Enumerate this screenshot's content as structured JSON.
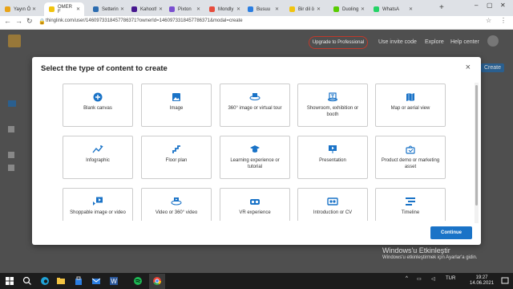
{
  "browser": {
    "tabs": [
      {
        "label": "Yayın Ö",
        "color": "#e8a317"
      },
      {
        "label": "OMER F",
        "color": "#f1c40f"
      },
      {
        "label": "Setterin",
        "color": "#2b6cb0"
      },
      {
        "label": "Kahoot!",
        "color": "#46178f"
      },
      {
        "label": "Pixton",
        "color": "#7a4fd0"
      },
      {
        "label": "Mondly",
        "color": "#e74c3c"
      },
      {
        "label": "Busuu",
        "color": "#2a7de1"
      },
      {
        "label": "Bir dil ö",
        "color": "#f1c40f"
      },
      {
        "label": "Duoling",
        "color": "#58cc02"
      },
      {
        "label": "WhatsA",
        "color": "#25d366"
      }
    ],
    "new_tab": "+",
    "url": "thinglink.com/user/1460973318457786371?ownerId=1460973318457786371&modal=create"
  },
  "page": {
    "upgrade_label": "Upgrade to Professional",
    "invite_label": "Use invite code",
    "explore_label": "Explore",
    "help_label": "Help center",
    "create_label": "Create"
  },
  "modal": {
    "title": "Select the type of content to create",
    "close": "×",
    "continue_label": "Continue",
    "items": [
      {
        "label": "Blank canvas",
        "icon": "plus-circle"
      },
      {
        "label": "Image",
        "icon": "image"
      },
      {
        "label": "360° image or virtual tour",
        "icon": "360"
      },
      {
        "label": "Showroom, exhibition or booth",
        "icon": "showroom"
      },
      {
        "label": "Map or aerial view",
        "icon": "map"
      },
      {
        "label": "Infographic",
        "icon": "infographic"
      },
      {
        "label": "Floor plan",
        "icon": "floor-plan"
      },
      {
        "label": "Learning experience or tutorial",
        "icon": "graduation"
      },
      {
        "label": "Presentation",
        "icon": "presentation"
      },
      {
        "label": "Product demo or marketing asset",
        "icon": "bag"
      },
      {
        "label": "Shoppable image or video",
        "icon": "shoppable"
      },
      {
        "label": "Video or 360° video",
        "icon": "video-360"
      },
      {
        "label": "VR experience",
        "icon": "vr"
      },
      {
        "label": "Introduction or CV",
        "icon": "cv"
      },
      {
        "label": "Timeline",
        "icon": "timeline"
      }
    ]
  },
  "watermark": {
    "title": "Windows'u Etkinleştir",
    "subtitle": "Windows'u etkinleştirmek için Ayarlar'a gidin."
  },
  "taskbar": {
    "time": "19:27",
    "date": "14.06.2021"
  },
  "accent_color": "#1a73c7"
}
